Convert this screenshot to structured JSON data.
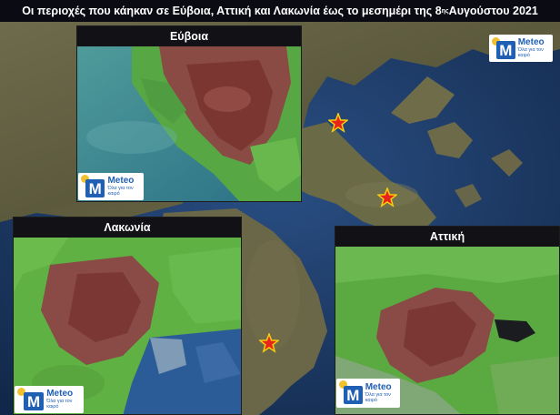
{
  "header": {
    "title_main": "Οι περιοχές που κάηκαν σε Εύβοια, Αττική και Λακωνία έως το μεσημέρι της 8",
    "title_sup": "ης",
    "title_end": " Αυγούστου 2021"
  },
  "insets": {
    "evia": {
      "label": "Εύβοια"
    },
    "lakonia": {
      "label": "Λακωνία"
    },
    "attiki": {
      "label": "Αττική"
    }
  },
  "logo": {
    "brand": "Meteo",
    "tagline": "Όλα για τον καιρό",
    "mark_letter": "M"
  },
  "markers": {
    "icon": "star-icon",
    "fill_color": "#e8231c",
    "outline_color": "#f5d10a"
  },
  "colors": {
    "burned": "#8b3a3a",
    "vegetation": "#4fa83a",
    "sea": "#1d3d6b",
    "banner_bg": "#0b0b14",
    "logo_blue": "#1f5fb4",
    "logo_sun": "#f2c12e"
  }
}
